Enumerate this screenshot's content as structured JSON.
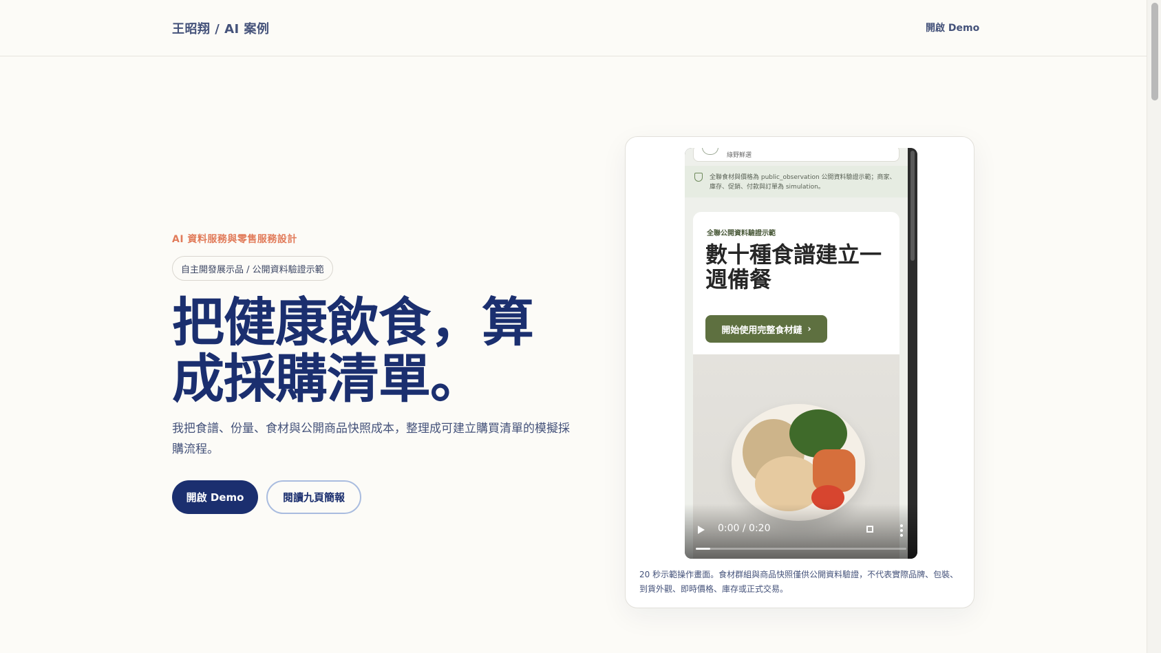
{
  "header": {
    "brand": "王昭翔 / AI 案例",
    "nav_demo": "開啟 Demo"
  },
  "hero": {
    "eyebrow": "AI 資料服務與零售服務設計",
    "chip": "自主開發展示品 / 公開資料驗證示範",
    "headline": "把健康飲食，算成採購清單。",
    "lead": "我把食譜、份量、食材與公開商品快照成本，整理成可建立購買清單的模擬採購流程。",
    "primary_button": "開啟 Demo",
    "secondary_button": "閱讀九頁簡報"
  },
  "video": {
    "top_card_text": "綠野鮮選",
    "notice": "全聯食材與價格為 public_observation 公開資料驗證示範；商家、庫存、促銷、付款與訂單為 simulation。",
    "kicker": "全聯公開資料驗證示範",
    "title": "數十種食譜建立一週備餐",
    "cta": "開始使用完整食材鏈",
    "cta_chevron": "›",
    "time": "0:00 / 0:20",
    "progress": 0.07,
    "icons": {
      "play": "play-icon",
      "fullscreen": "fullscreen-icon",
      "more": "more-vertical-icon"
    }
  },
  "caption": "20 秒示範操作畫面。食材群組與商品快照僅供公開資料驗證，不代表實際品牌、包裝、到貨外觀、即時價格、庫存或正式交易。",
  "colors": {
    "navy": "#1b2f6f",
    "accent": "#e17b5a",
    "olive": "#5e7040",
    "background": "#fcfbf7"
  }
}
